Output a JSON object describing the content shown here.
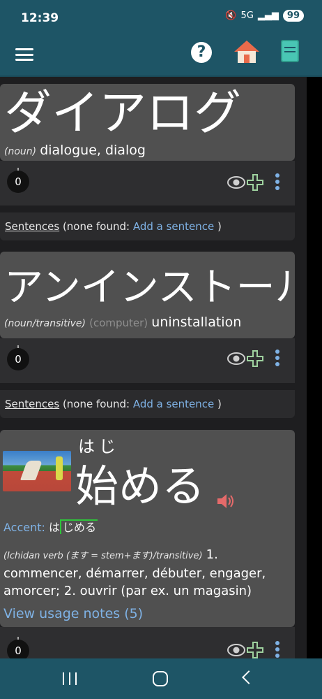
{
  "status": {
    "time": "12:39",
    "network": "5G",
    "battery": "99"
  },
  "appbar": {
    "menu": "menu-icon",
    "help": "help-icon",
    "home": "home-icon",
    "book": "book-icon"
  },
  "entries": [
    {
      "word": "ダイアログ",
      "pos": "(noun)",
      "definition": "dialogue, dialog",
      "count": "0",
      "sentences": {
        "label": "Sentences",
        "none_found": "(none found:",
        "add_link": "Add a sentence",
        "close": ")"
      }
    },
    {
      "word": "アンインストール",
      "pos_open": "(noun/",
      "pos_link": "transitive",
      "pos_close": ")",
      "field": "(computer)",
      "definition": "uninstallation",
      "count": "0",
      "sentences": {
        "label": "Sentences",
        "none_found": "(none found:",
        "add_link": "Add a sentence",
        "close": ")"
      }
    },
    {
      "furigana": "はじ",
      "word": "始める",
      "accent_label": "Accent:",
      "accent_first": "は",
      "accent_rest": "じめる",
      "pos_link": "(Ichidan verb (ます = stem+ます)/transitive)",
      "definition": "1. commencer, démarrer, débuter, engager, amorcer; 2. ouvrir (par ex. un magasin)",
      "usage_notes": "View usage notes (5)",
      "count": "0"
    }
  ],
  "colors": {
    "bar": "#1e5566",
    "link": "#7fb2e5",
    "card": "#505050",
    "plus": "#9fd29f",
    "accent_line": "#2ec43a"
  }
}
